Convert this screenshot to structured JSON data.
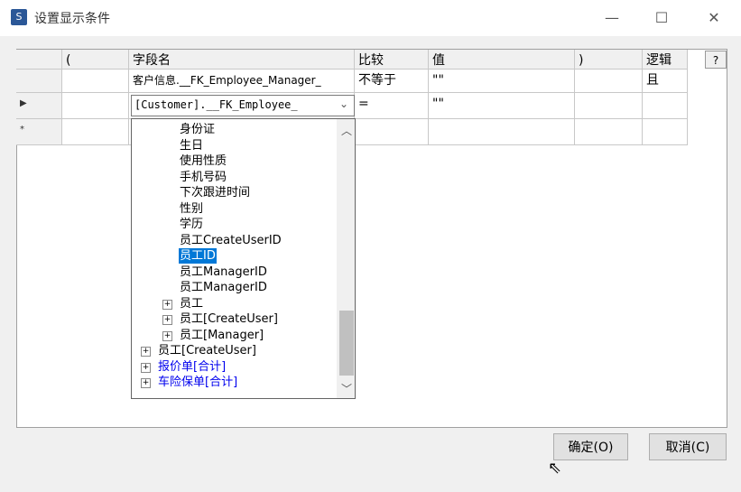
{
  "window": {
    "title": "设置显示条件",
    "minimize": "—",
    "maximize": "☐",
    "close": "✕",
    "app_icon": "S"
  },
  "grid": {
    "headers": [
      "",
      "(",
      "字段名",
      "比较",
      "值",
      ")",
      "逻辑"
    ],
    "help_label": "?",
    "rows": [
      {
        "indicator": "",
        "open": "",
        "field": "客户信息.__FK_Employee_Manager_",
        "compare": "不等于",
        "value": "\"\"",
        "close": "",
        "logic": "且"
      },
      {
        "indicator": "▶",
        "open": "",
        "field": "[Customer].__FK_Employee_",
        "compare": "=",
        "value": "\"\"",
        "close": "",
        "logic": ""
      },
      {
        "indicator": "*",
        "open": "",
        "field": "",
        "compare": "",
        "value": "",
        "close": "",
        "logic": ""
      }
    ]
  },
  "tree": {
    "items": [
      {
        "label": "身份证",
        "level": 2
      },
      {
        "label": "生日",
        "level": 2
      },
      {
        "label": "使用性质",
        "level": 2
      },
      {
        "label": "手机号码",
        "level": 2
      },
      {
        "label": "下次跟进时间",
        "level": 2
      },
      {
        "label": "性别",
        "level": 2
      },
      {
        "label": "学历",
        "level": 2
      },
      {
        "label": "员工CreateUserID",
        "level": 2
      },
      {
        "label": "员工ID",
        "level": 2,
        "selected": true
      },
      {
        "label": "员工ManagerID",
        "level": 2
      },
      {
        "label": "员工ManagerID",
        "level": 2
      },
      {
        "label": "员工",
        "level": 2,
        "expandable": true
      },
      {
        "label": "员工[CreateUser]",
        "level": 2,
        "expandable": true
      },
      {
        "label": "员工[Manager]",
        "level": 2,
        "expandable": true
      },
      {
        "label": "员工[CreateUser]",
        "level": 1,
        "expandable": true
      },
      {
        "label": "报价单[合计]",
        "level": 1,
        "expandable": true,
        "blue": true
      },
      {
        "label": "车险保单[合计]",
        "level": 1,
        "expandable": true,
        "blue": true
      }
    ]
  },
  "buttons": {
    "ok": "确定(O)",
    "cancel": "取消(C)"
  }
}
